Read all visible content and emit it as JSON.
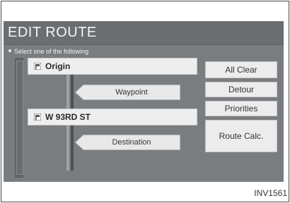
{
  "screen": {
    "title": "EDIT ROUTE",
    "instruction": "Select one of the following"
  },
  "route": {
    "origin_label": "Origin",
    "waypoint_label": "Waypoint",
    "street_label": "W 93RD ST",
    "destination_label": "Destination"
  },
  "actions": {
    "all_clear": "All Clear",
    "detour": "Detour",
    "priorities": "Priorities",
    "route_calc": "Route Calc."
  },
  "caption": "INV1561",
  "colors": {
    "screen_bg": "#7a7d80",
    "title_text": "#f4f4f4",
    "button_bg": "#ececec"
  },
  "icons": {
    "origin": "flag-icon",
    "street": "flag-icon"
  }
}
